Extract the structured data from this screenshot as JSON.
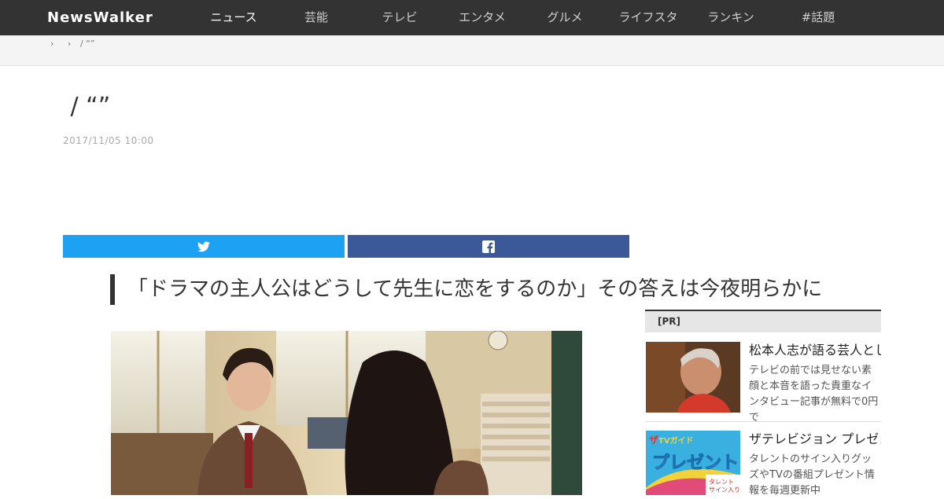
{
  "header": {
    "logo": "NewsWalker",
    "nav": [
      {
        "label": "ニュース",
        "active": true
      },
      {
        "label": "芸能",
        "active": false
      },
      {
        "label": "テレビ",
        "active": false
      },
      {
        "label": "エンタメ",
        "active": false
      },
      {
        "label": "グルメ",
        "active": false
      },
      {
        "label": "ライフスタイル",
        "active": false
      },
      {
        "label": "ランキング",
        "active": false
      },
      {
        "label": "#話題",
        "active": false
      }
    ]
  },
  "breadcrumb": {
    "items": [
      "›",
      "›",
      "/ “”"
    ]
  },
  "article": {
    "title": " / “”",
    "date": "2017/11/05 10:00",
    "subheading": "「ドラマの主人公はどうして先生に恋をするのか」その答えは今夜明らかに",
    "share": {
      "twitter_icon": "twitter-icon",
      "facebook_icon": "facebook-icon",
      "twitter_color": "#1da1f2",
      "facebook_color": "#3b5998"
    }
  },
  "sidebar": {
    "pr_label": "[PR]",
    "items": [
      {
        "title": "松本人志が語る芸人としての生き方",
        "description": "テレビの前では見せない素顔と本音を語った貴重なインタビュー記事が無料で0円で"
      },
      {
        "title": "ザテレビジョン プレゼント",
        "description": "タレントのサイン入りグッズやTVの番組プレゼント情報を毎週更新中"
      }
    ]
  }
}
